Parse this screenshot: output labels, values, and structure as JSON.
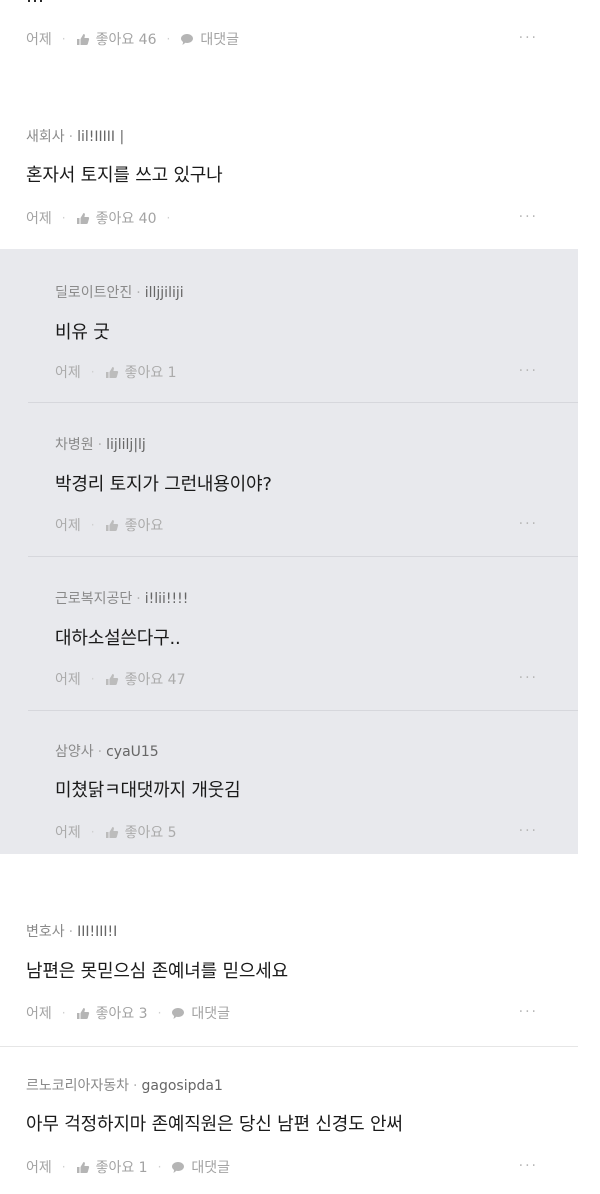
{
  "comments": [
    {
      "meta_date": "어제",
      "like_label": "좋아요 46",
      "reply_label": "대댓글"
    },
    {
      "author": "새회사",
      "uid": "lil!IIIII |",
      "text": "혼자서 토지를 쓰고 있구나",
      "meta_date": "어제",
      "like_label": "좋아요 40"
    }
  ],
  "replies": [
    {
      "author": "딜로이트안진",
      "uid": "illjjiliji",
      "text": "비유 굿",
      "meta_date": "어제",
      "like_label": "좋아요 1"
    },
    {
      "author": "차병원",
      "uid": "lijlilj|lj",
      "text": "박경리 토지가 그런내용이야?",
      "meta_date": "어제",
      "like_label": "좋아요"
    },
    {
      "author": "근로복지공단",
      "uid": "i!lii!!!!",
      "text": "대하소설쓴다구..",
      "meta_date": "어제",
      "like_label": "좋아요 47"
    },
    {
      "author": "삼양사",
      "uid": "cyaU15",
      "text": "미쳤닭ㅋ대댓까지 개웃김",
      "meta_date": "어제",
      "like_label": "좋아요 5"
    }
  ],
  "bottom_comments": [
    {
      "author": "변호사",
      "uid": "III!III!I",
      "text": "남편은 못믿으심 존예녀를 믿으세요",
      "meta_date": "어제",
      "like_label": "좋아요 3",
      "reply_label": "대댓글"
    },
    {
      "author": "르노코리아자동차",
      "uid": "gagosipda1",
      "text": "아무 걱정하지마 존예직원은 당신 남편 신경도 안써",
      "meta_date": "어제",
      "like_label": "좋아요 1",
      "reply_label": "대댓글"
    }
  ],
  "more_label": "···",
  "dot": "·"
}
